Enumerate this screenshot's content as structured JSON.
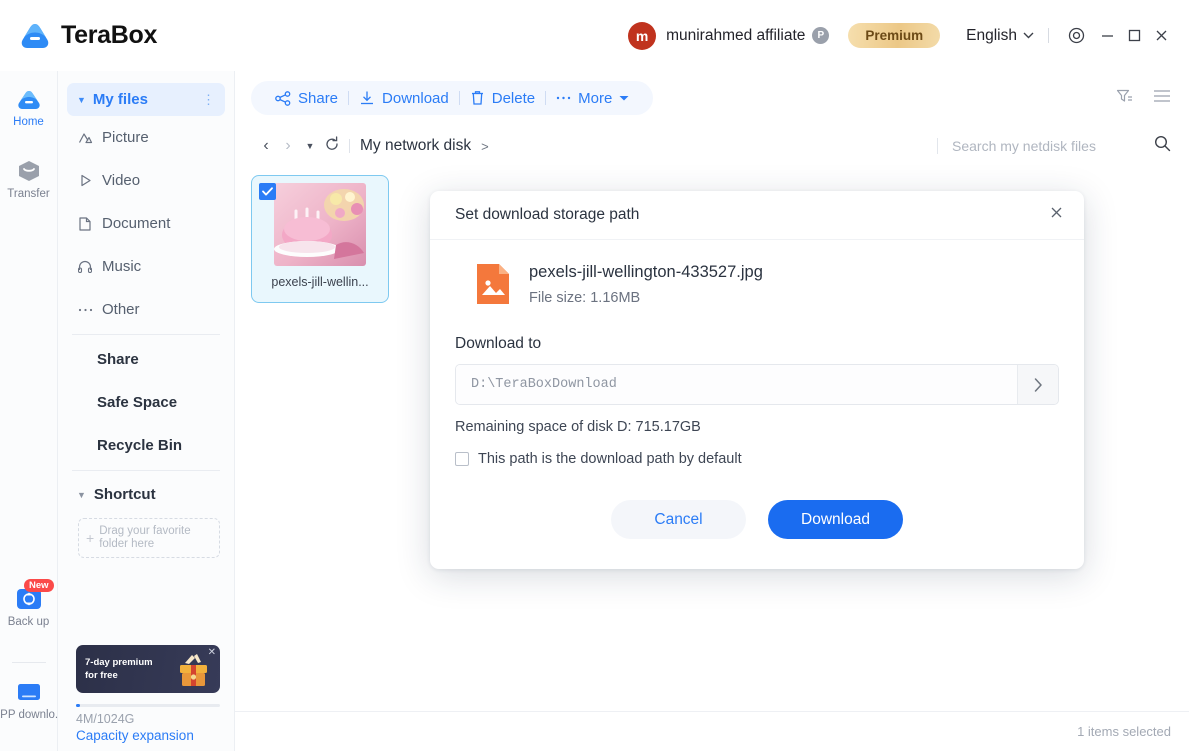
{
  "titlebar": {
    "brand": "TeraBox",
    "avatar_initial": "m",
    "username": "munirahmed affiliate",
    "p_badge": "P",
    "premium_label": "Premium",
    "language": "English",
    "icons": {
      "gear": "gear-icon",
      "minimize": "minimize-icon",
      "maximize": "maximize-icon",
      "close": "close-icon"
    }
  },
  "rail": {
    "items": [
      {
        "label": "Home",
        "icon": "cloud-icon",
        "active": true,
        "badge": ""
      },
      {
        "label": "Transfer",
        "icon": "box-icon",
        "active": false,
        "badge": ""
      },
      {
        "label": "Back up",
        "icon": "sync-icon",
        "active": false,
        "badge": "New"
      },
      {
        "label": "APP downlo...",
        "icon": "monitor-icon",
        "active": false,
        "badge": ""
      }
    ]
  },
  "sidebar": {
    "header": {
      "label": "My files",
      "menu_icon": "more-vertical-icon"
    },
    "items": [
      {
        "label": "Picture",
        "icon": "picture-icon"
      },
      {
        "label": "Video",
        "icon": "video-icon"
      },
      {
        "label": "Document",
        "icon": "document-icon"
      },
      {
        "label": "Music",
        "icon": "music-icon"
      },
      {
        "label": "Other",
        "icon": "other-icon"
      }
    ],
    "links": [
      {
        "label": "Share"
      },
      {
        "label": "Safe Space"
      },
      {
        "label": "Recycle Bin"
      }
    ],
    "shortcut": {
      "label": "Shortcut",
      "dropzone": "Drag your favorite folder here"
    },
    "promo": {
      "line1": "7-day premium",
      "line2": "for free",
      "close_icon": "close-icon"
    },
    "storage": {
      "usage": "4M/1024G",
      "expand_label": "Capacity expansion",
      "percent": 1
    }
  },
  "toolbar": {
    "share": "Share",
    "download": "Download",
    "delete": "Delete",
    "more": "More",
    "filter_icon": "filter-icon",
    "list_icon": "list-view-icon"
  },
  "breadcrumb": {
    "back_icon": "chevron-left-icon",
    "forward_icon": "chevron-right-icon",
    "history_icon": "chevron-down-icon",
    "refresh_icon": "refresh-icon",
    "path": "My network disk",
    "path_arrow": ">"
  },
  "search": {
    "placeholder": "Search my netdisk files",
    "icon": "search-icon"
  },
  "files": [
    {
      "name": "pexels-jill-wellin...",
      "selected": true
    }
  ],
  "statusbar": {
    "selection": "1 items selected"
  },
  "modal": {
    "title": "Set download storage path",
    "close_icon": "close-icon",
    "file": {
      "icon": "image-file-icon",
      "name": "pexels-jill-wellington-433527.jpg",
      "size_label": "File size: 1.16MB"
    },
    "download_to_label": "Download to",
    "path_value": "D:\\TeraBoxDownload",
    "path_browse_icon": "chevron-right-icon",
    "remaining_space": "Remaining space of disk D: 715.17GB",
    "default_checkbox": {
      "label": "This path is the download path by default",
      "checked": false
    },
    "cancel_label": "Cancel",
    "download_label": "Download"
  },
  "colors": {
    "accent": "#2b7cf6",
    "download_button": "#1a6cf0",
    "premium_gold": "#ecc887",
    "avatar_red": "#c0331e",
    "badge_red": "#fb4a49",
    "file_icon_orange": "#f4783c"
  }
}
